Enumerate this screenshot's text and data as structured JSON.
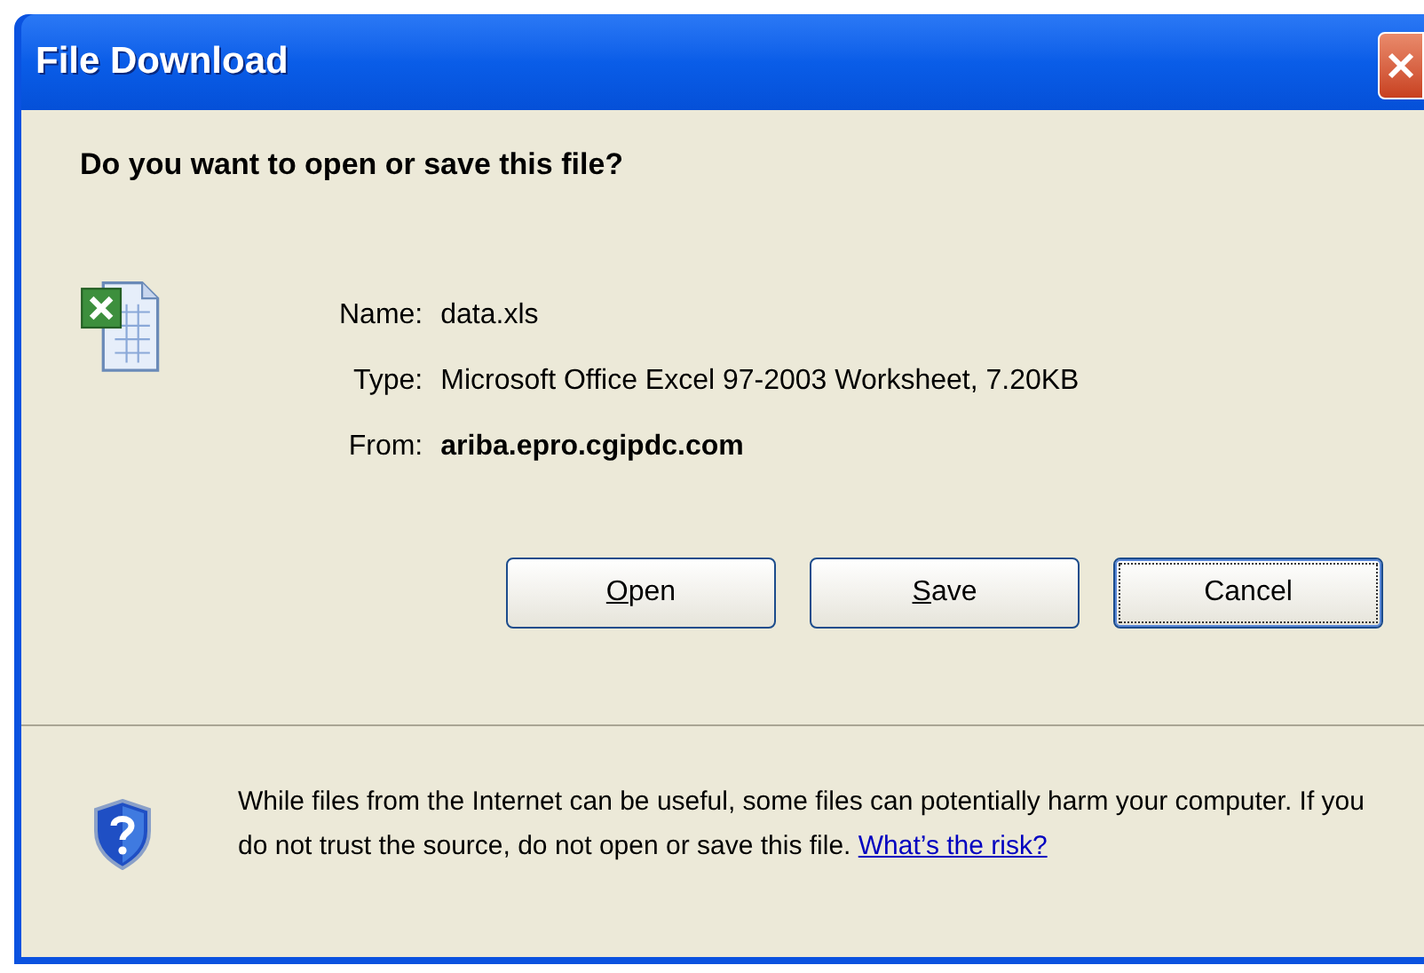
{
  "window": {
    "title": "File Download"
  },
  "question": "Do you want to open or save this file?",
  "file_details": [
    {
      "label": "Name:",
      "value": "data.xls",
      "bold": false
    },
    {
      "label": "Type:",
      "value": "Microsoft Office Excel 97-2003 Worksheet, 7.20KB",
      "bold": false
    },
    {
      "label": "From:",
      "value": "ariba.epro.cgipdc.com",
      "bold": true
    }
  ],
  "buttons": [
    {
      "label": "Open",
      "mnemonic": true,
      "focused": false
    },
    {
      "label": "Save",
      "mnemonic": true,
      "focused": false
    },
    {
      "label": "Cancel",
      "mnemonic": false,
      "focused": true
    }
  ],
  "warning": {
    "text": "While files from the Internet can be useful, some files can potentially harm your computer. If you do not trust the source, do not open or save this file.",
    "link": "What’s the risk?"
  }
}
